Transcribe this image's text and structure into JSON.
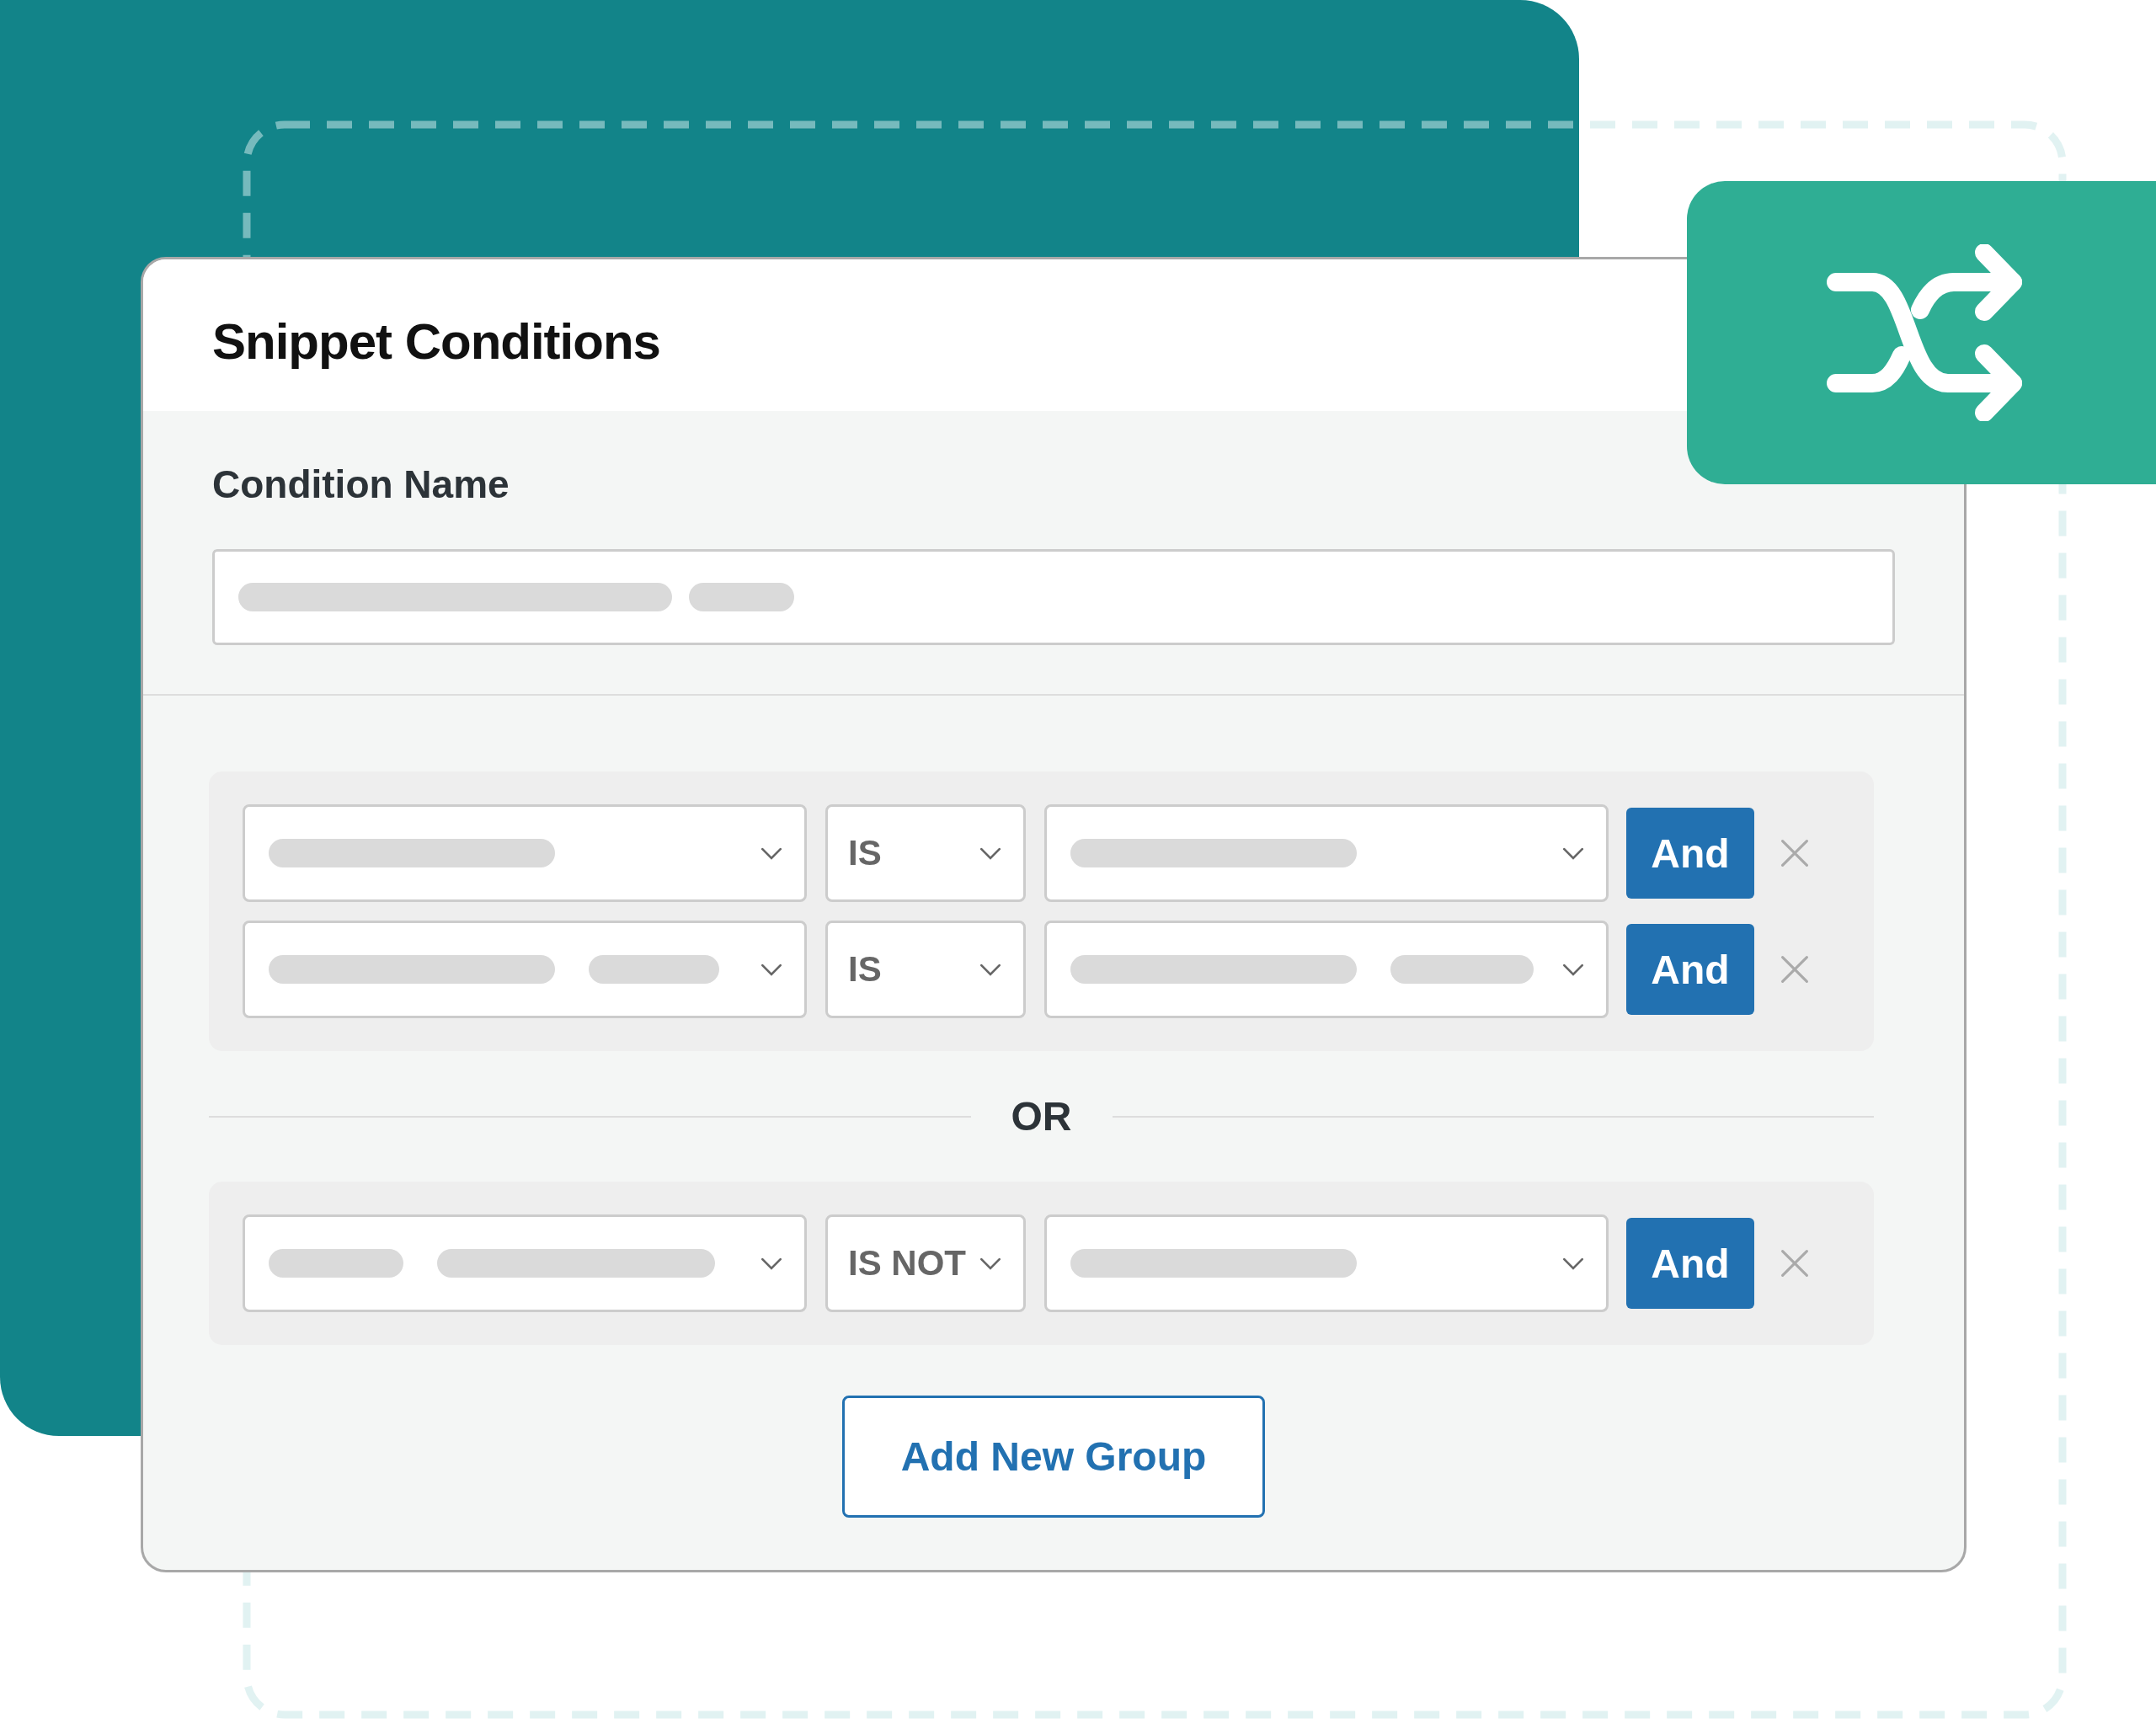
{
  "card": {
    "title": "Snippet Conditions"
  },
  "condition_name": {
    "label": "Condition Name"
  },
  "groups": [
    {
      "rows": [
        {
          "operator": "IS",
          "button": "And"
        },
        {
          "operator": "IS",
          "button": "And"
        }
      ]
    },
    {
      "rows": [
        {
          "operator": "IS NOT",
          "button": "And"
        }
      ]
    }
  ],
  "separator": "OR",
  "add_button": "Add New Group"
}
